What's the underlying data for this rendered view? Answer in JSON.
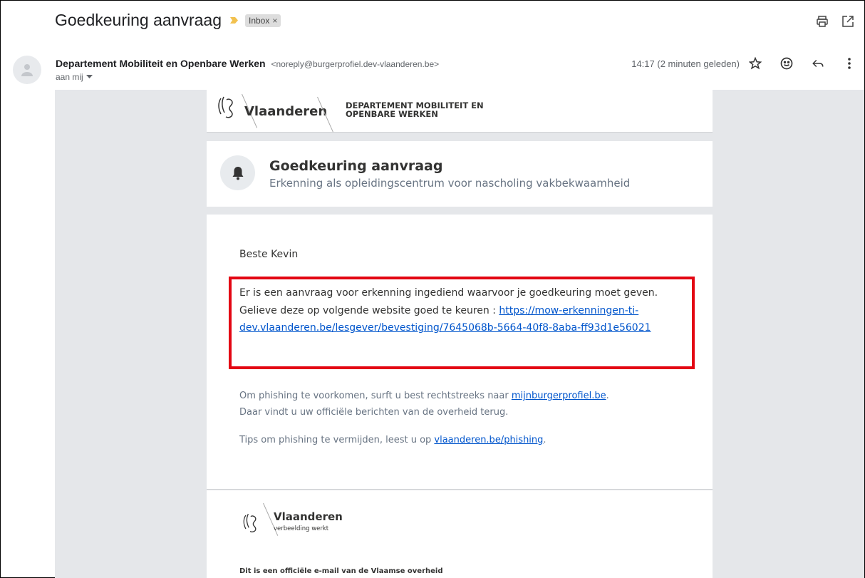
{
  "header": {
    "subject": "Goedkeuring aanvraag",
    "label": "Inbox",
    "label_close": "×",
    "icons": [
      "print-icon",
      "open-new-window-icon"
    ],
    "importance_color": "#f2c14e"
  },
  "message": {
    "sender_name": "Departement Mobiliteit en Openbare Werken",
    "sender_email": "<noreply@burgerprofiel.dev-vlaanderen.be>",
    "to": "aan mij",
    "time": "14:17 (2 minuten geleden)",
    "actions": [
      "star-icon",
      "emoji-icon",
      "reply-icon",
      "more-icon"
    ]
  },
  "email": {
    "logo_text": "Vlaanderen",
    "dept_line1": "DEPARTEMENT MOBILITEIT EN",
    "dept_line2": "OPENBARE WERKEN",
    "notice_title": "Goedkeuring aanvraag",
    "notice_subtitle": "Erkenning als opleidingscentrum voor nascholing vakbekwaamheid",
    "greeting": "Beste Kevin",
    "main_text": "Er is een aanvraag voor erkenning ingediend waarvoor je goedkeuring moet geven. Gelieve deze op volgende website goed te keuren : ",
    "main_link": "https://mow-erkenningen-ti-dev.vlaanderen.be/lesgever/bevestiging/7645068b-5664-40f8-8aba-ff93d1e56021",
    "phishing_text1": "Om phishing te voorkomen, surft u best rechtstreeks naar ",
    "phishing_link1": "mijnburgerprofiel.be",
    "phishing_text1b": ".",
    "phishing_text1c": "Daar vindt u uw officiële berichten van de overheid terug.",
    "phishing_text2": "Tips om phishing te vermijden, leest u op ",
    "phishing_link2": "vlaanderen.be/phishing",
    "phishing_text2b": ".",
    "footer_logo": "Vlaanderen",
    "footer_motto": "verbeelding werkt",
    "footer_official": "Dit is een officiële e-mail van de Vlaamse overheid",
    "highlight_color": "#e30613"
  }
}
